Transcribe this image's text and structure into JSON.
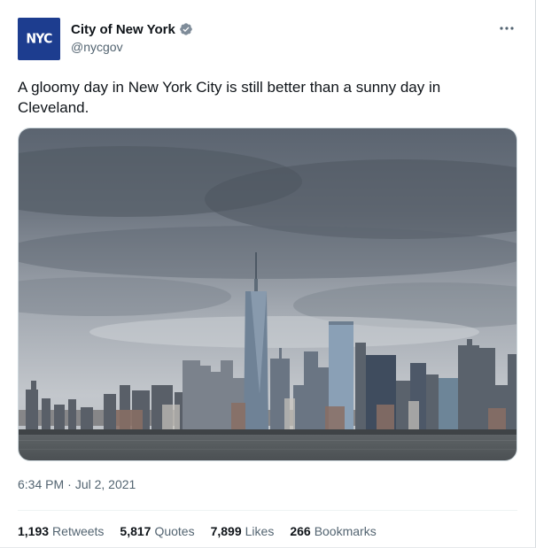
{
  "account": {
    "avatar_text": "NYC",
    "display_name": "City of New York",
    "handle": "@nycgov",
    "verified": true
  },
  "icons": {
    "more": "more-horizontal-icon",
    "verified": "verified-badge-icon"
  },
  "tweet": {
    "text": "A gloomy day in New York City is still better than a sunny day in Cleveland.",
    "time": "6:34 PM",
    "separator": "·",
    "date": "Jul 2, 2021"
  },
  "stats": [
    {
      "value": "1,193",
      "label": "Retweets"
    },
    {
      "value": "5,817",
      "label": "Quotes"
    },
    {
      "value": "7,899",
      "label": "Likes"
    },
    {
      "value": "266",
      "label": "Bookmarks"
    }
  ],
  "colors": {
    "text_primary": "#0f1419",
    "text_secondary": "#536471",
    "avatar_bg": "#1d3d8f",
    "verified_badge": "#7f8c99"
  }
}
